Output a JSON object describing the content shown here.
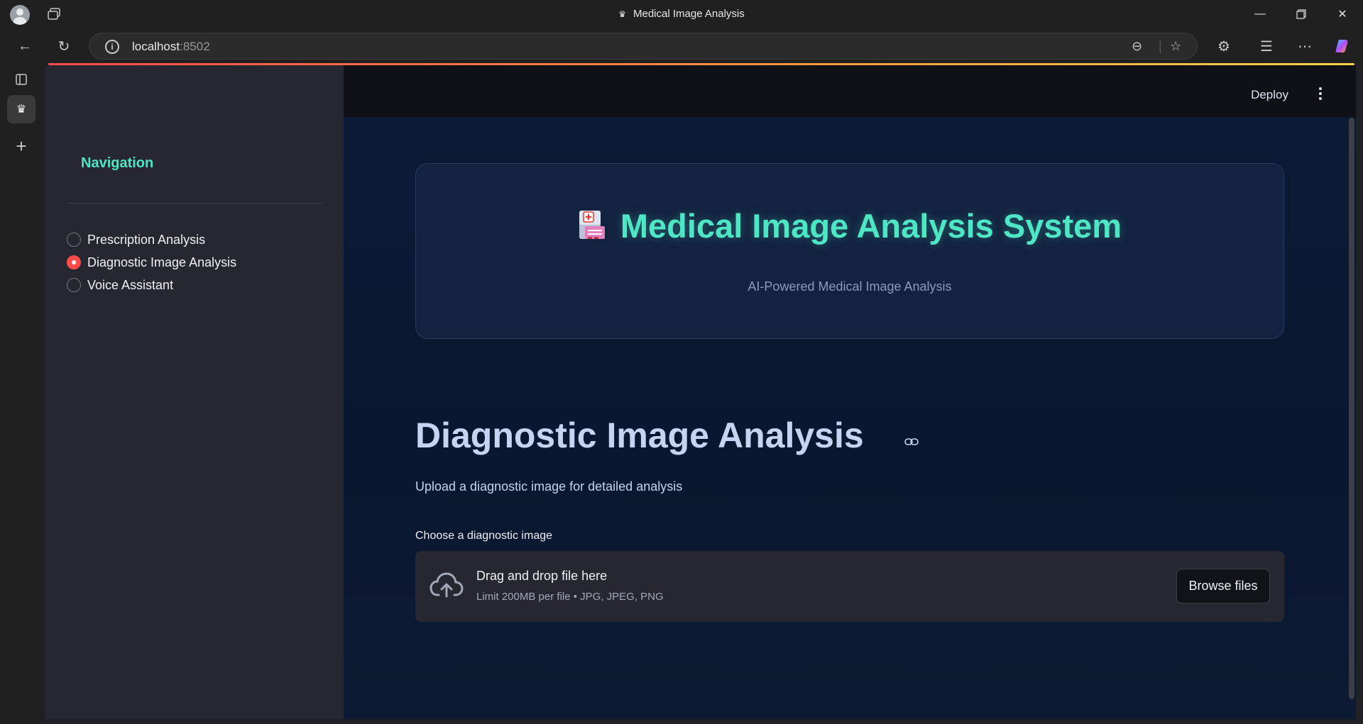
{
  "browser": {
    "window_title": "Medical Image Analysis",
    "url_host": "localhost",
    "url_port": ":8502"
  },
  "sidebar": {
    "nav_title": "Navigation",
    "items": [
      {
        "label": "Prescription Analysis",
        "selected": false
      },
      {
        "label": "Diagnostic Image Analysis",
        "selected": true
      },
      {
        "label": "Voice Assistant",
        "selected": false
      }
    ]
  },
  "header": {
    "deploy_label": "Deploy"
  },
  "hero": {
    "title": "Medical Image Analysis System",
    "subtitle": "AI-Powered Medical Image Analysis"
  },
  "main": {
    "page_title": "Diagnostic Image Analysis",
    "description": "Upload a diagnostic image for detailed analysis",
    "uploader": {
      "label": "Choose a diagnostic image",
      "drop_text": "Drag and drop file here",
      "limit_text": "Limit 200MB per file • JPG, JPEG, PNG",
      "browse_label": "Browse files"
    }
  },
  "colors": {
    "accent": "#4ee6c4",
    "radio_selected": "#ff4b4b",
    "main_bg": "#0c1a36",
    "sidebar_bg": "#262730"
  }
}
